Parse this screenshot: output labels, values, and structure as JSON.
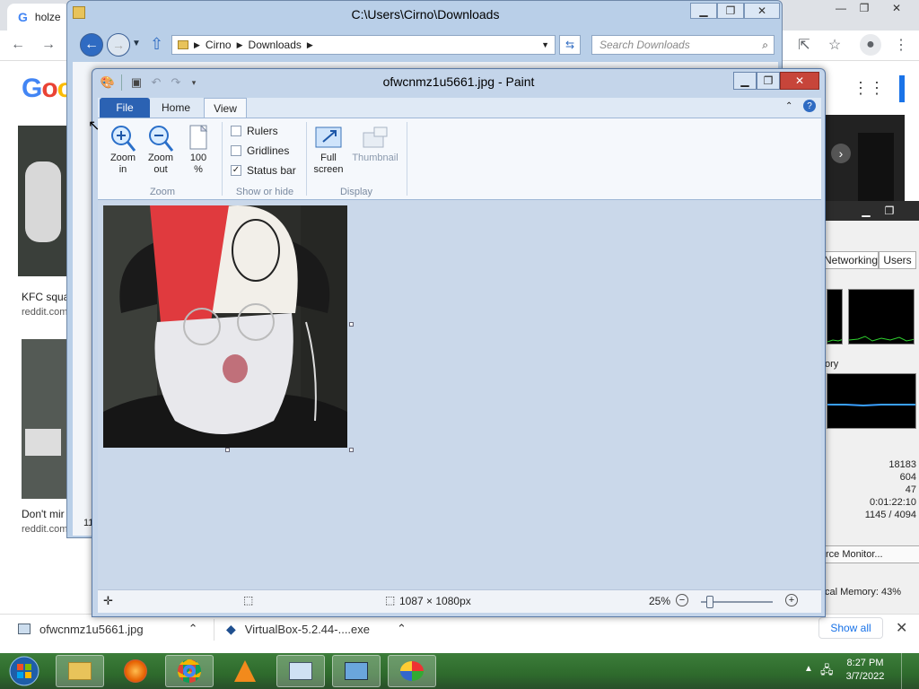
{
  "chrome": {
    "tab_title": "holze",
    "results": [
      {
        "caption": "KFC squa",
        "source": "reddit.com"
      },
      {
        "caption": "Don't mir",
        "source": "reddit.com"
      }
    ],
    "partial_count": "11",
    "downloads": [
      {
        "name": "ofwcnmz1u5661.jpg"
      },
      {
        "name": "VirtualBox-5.2.44-....exe"
      }
    ],
    "show_all": "Show all"
  },
  "explorer": {
    "title": "C:\\Users\\Cirno\\Downloads",
    "breadcrumb": [
      "Cirno",
      "Downloads"
    ],
    "search_placeholder": "Search Downloads"
  },
  "taskmgr": {
    "tabs": [
      "Networking",
      "Users"
    ],
    "memory_label": "ory",
    "stats": [
      "18183",
      "604",
      "47",
      "0:01:22:10",
      "1145 / 4094"
    ],
    "resource_monitor": "rce Monitor...",
    "physical_memory": "cal Memory: 43%"
  },
  "paint": {
    "title": "ofwcnmz1u5661.jpg - Paint",
    "tabs": {
      "file": "File",
      "home": "Home",
      "view": "View"
    },
    "zoom_group": {
      "label": "Zoom",
      "zoom_in": [
        "Zoom",
        "in"
      ],
      "zoom_out": [
        "Zoom",
        "out"
      ],
      "hundred": [
        "100",
        "%"
      ]
    },
    "show_hide_group": {
      "label": "Show or hide",
      "rulers": {
        "label": "Rulers",
        "checked": false
      },
      "gridlines": {
        "label": "Gridlines",
        "checked": false
      },
      "status_bar": {
        "label": "Status bar",
        "checked": true
      }
    },
    "display_group": {
      "label": "Display",
      "full_screen": [
        "Full",
        "screen"
      ],
      "thumbnail": "Thumbnail"
    },
    "status": {
      "image_size": "1087 × 1080px",
      "zoom": "25%"
    }
  },
  "taskbar": {
    "time": "8:27 PM",
    "date": "3/7/2022"
  },
  "colors": {
    "paint_frame": "#c4d5ea",
    "file_tab": "#2b62b3",
    "taskbar": "#2e6a2c",
    "close_button": "#c7453a"
  }
}
